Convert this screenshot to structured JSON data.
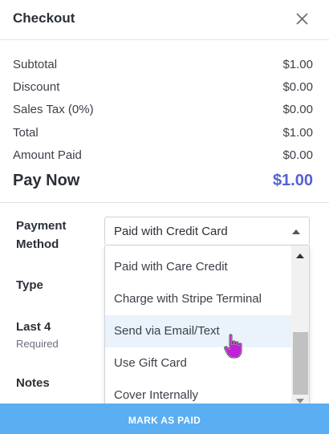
{
  "header": {
    "title": "Checkout",
    "close_icon": "close-icon"
  },
  "summary": {
    "rows": [
      {
        "label": "Subtotal",
        "value": "$1.00"
      },
      {
        "label": "Discount",
        "value": "$0.00"
      },
      {
        "label": "Sales Tax (0%)",
        "value": "$0.00"
      },
      {
        "label": "Total",
        "value": "$1.00"
      },
      {
        "label": "Amount Paid",
        "value": "$0.00"
      }
    ],
    "pay_now": {
      "label": "Pay Now",
      "value": "$1.00",
      "color": "#5561d6"
    }
  },
  "form": {
    "payment_method": {
      "label_line1": "Payment",
      "label_line2": "Method",
      "selected": "Paid with Credit Card",
      "options": [
        "Paid with Care Credit",
        "Charge with Stripe Terminal",
        "Send via Email/Text",
        "Use Gift Card",
        "Cover Internally"
      ],
      "hovered_option": "Send via Email/Text"
    },
    "type": {
      "label": "Type"
    },
    "last4": {
      "label": "Last 4",
      "hint": "Required"
    },
    "notes": {
      "label": "Notes"
    }
  },
  "footer": {
    "button_label": "MARK AS PAID",
    "color": "#5aaef1"
  },
  "icons": {
    "caret": "caret-up-icon",
    "cursor": "hand-pointer-icon"
  }
}
